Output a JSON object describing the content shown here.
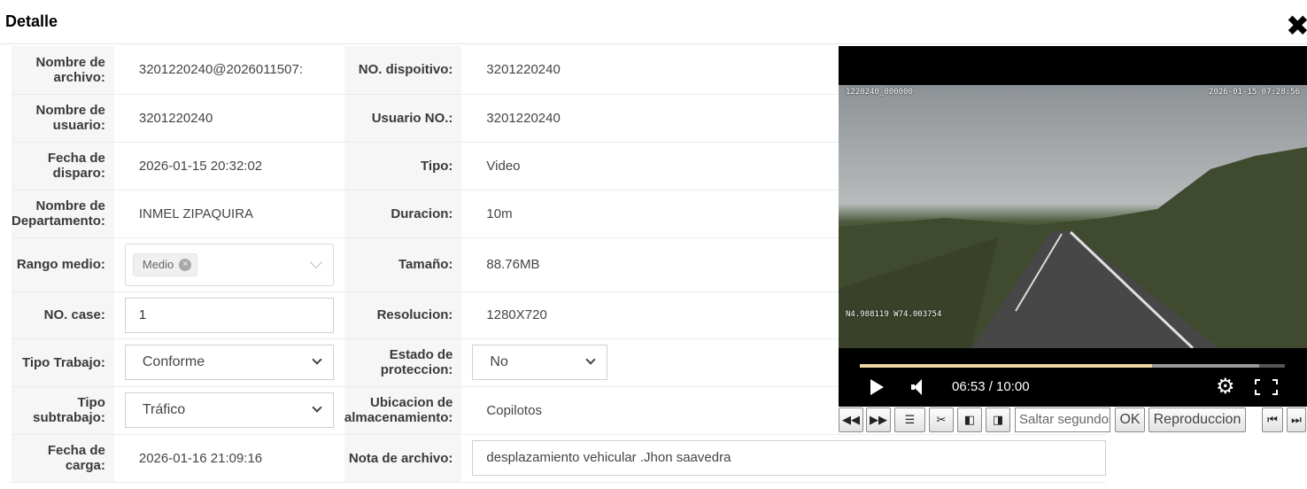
{
  "dialog": {
    "title": "Detalle",
    "close_icon": "✖"
  },
  "fields": {
    "file_name": {
      "label": "Nombre de archivo:",
      "value": "3201220240@2026011507:"
    },
    "device_no": {
      "label": "NO. dispoitivo:",
      "value": "3201220240"
    },
    "user_name": {
      "label": "Nombre de usuario:",
      "value": "3201220240"
    },
    "user_no": {
      "label": "Usuario NO.:",
      "value": "3201220240"
    },
    "trigger_date": {
      "label": "Fecha de disparo:",
      "value": "2026-01-15 20:32:02"
    },
    "type": {
      "label": "Tipo:",
      "value": "Video"
    },
    "department": {
      "label": "Nombre de Departamento:",
      "value": "INMEL ZIPAQUIRA"
    },
    "duration": {
      "label": "Duracion:",
      "value": "10m"
    },
    "media_range": {
      "label": "Rango medio:",
      "tag": "Medio"
    },
    "size": {
      "label": "Tamaño:",
      "value": "88.76MB"
    },
    "case_no": {
      "label": "NO. case:",
      "value": "1"
    },
    "resolution": {
      "label": "Resolucion:",
      "value": "1280X720"
    },
    "work_type": {
      "label": "Tipo Trabajo:",
      "selected": "Conforme"
    },
    "protection": {
      "label": "Estado de proteccion:",
      "selected": "No"
    },
    "work_subtype": {
      "label": "Tipo subtrabajo:",
      "selected": "Tráfico"
    },
    "storage": {
      "label": "Ubicacion de almacenamiento:",
      "value": "Copilotos"
    },
    "upload_date": {
      "label": "Fecha de carga:",
      "value": "2026-01-16 21:09:16"
    },
    "file_note": {
      "label": "Nota de archivo:",
      "value": "desplazamiento vehicular .Jhon saavedra"
    }
  },
  "player": {
    "osd_top_left": "1220240_000000",
    "osd_top_right": "2026-01-15 07:28:56",
    "osd_bottom_left": "N4.988119 W74.003754",
    "time_display": "06:53 / 10:00",
    "progress_fraction": 0.688,
    "icons": [
      "play-icon",
      "volume-icon",
      "gear-icon",
      "fullscreen-icon"
    ]
  },
  "toolbar": {
    "rewind": "◀◀",
    "forward": "▶▶",
    "list": "☰",
    "cut": "✂",
    "prev_frame": "◧",
    "next_frame": "◨",
    "seek_placeholder": "Saltar segundos",
    "ok": "OK",
    "playback": "Reproduccion",
    "first": "⏮",
    "last": "⏭"
  }
}
